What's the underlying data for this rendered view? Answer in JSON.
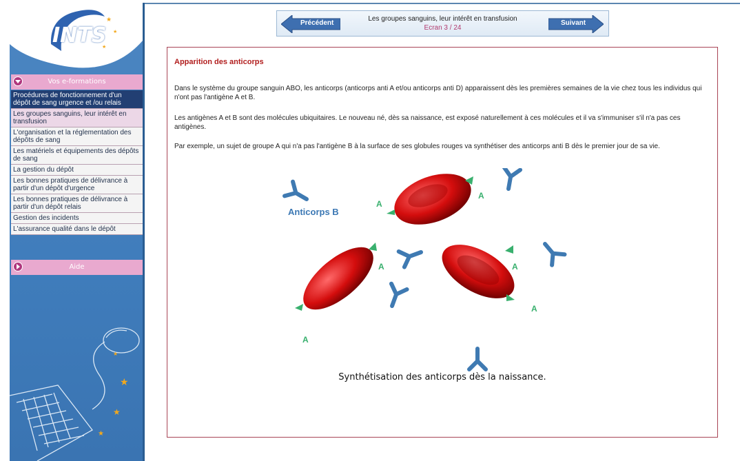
{
  "sidebar": {
    "logo_text": "INTS",
    "menu_header": "Vos e-formations",
    "items": [
      {
        "label": "Procédures de fonctionnement d'un dépôt de sang urgence et /ou relais",
        "state": "active"
      },
      {
        "label": "Les groupes sanguins, leur intérêt en transfusion",
        "state": "hover"
      },
      {
        "label": "L'organisation et la réglementation des dépôts de sang",
        "state": "normal"
      },
      {
        "label": "Les matériels et équipements des dépôts de sang",
        "state": "normal"
      },
      {
        "label": "La gestion du dépôt",
        "state": "normal"
      },
      {
        "label": "Les bonnes pratiques de délivrance à partir d'un dépôt d'urgence",
        "state": "normal"
      },
      {
        "label": "Les bonnes pratiques de délivrance à partir d'un dépôt relais",
        "state": "normal"
      },
      {
        "label": "Gestion des incidents",
        "state": "normal"
      },
      {
        "label": "L'assurance qualité dans le dépôt",
        "state": "normal"
      }
    ],
    "aide_label": "Aide"
  },
  "nav": {
    "prev_label": "Précédent",
    "next_label": "Suivant",
    "title": "Les groupes sanguins, leur intérêt en transfusion",
    "screen": "Ecran 3 / 24"
  },
  "content": {
    "heading": "Apparition des anticorps",
    "paragraphs": [
      "Dans le système du groupe sanguin ABO, les anticorps (anticorps anti A et/ou anticorps anti D) apparaissent dès les premières semaines de la vie chez tous les individus qui n'ont pas l'antigène A et B.",
      "Les antigènes A et B sont des molécules ubiquitaires. Le nouveau né, dès sa naissance, est exposé naturellement à ces molécules et il va s'immuniser s'il n'a pas ces antigènes.",
      "Par exemple, un sujet de groupe A qui n'a pas l'antigène B à la surface de ses globules rouges va synthétiser des anticorps anti B dès le premier jour de sa vie."
    ],
    "illustration": {
      "antibody_label": "Anticorps B",
      "antigen_label": "A",
      "caption": "Synthétisation des anticorps dès la naissance."
    }
  },
  "colors": {
    "sidebar_blue": "#3f7cbb",
    "menu_pink": "#e9a9cf",
    "active_item": "#223f73",
    "heading_red": "#b11d1d",
    "antigen_green": "#39b06e",
    "antibody_blue": "#3c78b4"
  }
}
